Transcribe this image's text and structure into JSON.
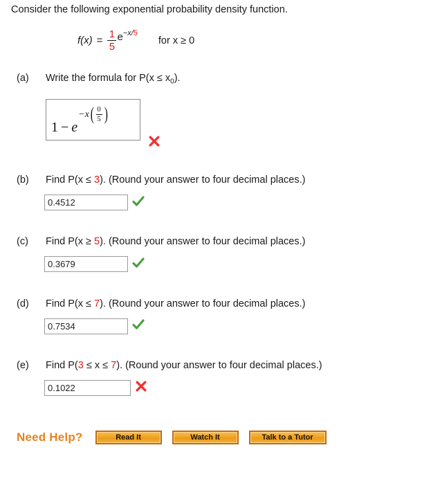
{
  "intro": "Consider the following exponential probability density function.",
  "pdf_formula": {
    "lhs": "f(x)",
    "equals": "=",
    "fraction_numerator": "1",
    "fraction_denominator": "5",
    "e_base": "e",
    "exponent_prefix": "−x/",
    "exponent_red": "5",
    "domain": "for x ≥ 0"
  },
  "parts": [
    {
      "tag": "(a)",
      "text_before": "Write the formula for P(x ≤ x",
      "subscript": "0",
      "text_after": ").",
      "answer_type": "math",
      "math": {
        "one": "1",
        "minus": "−",
        "e": "e",
        "exp_minus_x": "−x",
        "exp_num": "0",
        "exp_den": "5"
      },
      "mark": "cross"
    },
    {
      "tag": "(b)",
      "prompt_prefix": "Find P(x ≤ ",
      "prompt_value": "3",
      "prompt_suffix": "). (Round your answer to four decimal places.)",
      "answer_type": "input",
      "value": "0.4512",
      "mark": "check"
    },
    {
      "tag": "(c)",
      "prompt_prefix": "Find P(x ≥ ",
      "prompt_value": "5",
      "prompt_suffix": "). (Round your answer to four decimal places.)",
      "answer_type": "input",
      "value": "0.3679",
      "mark": "check"
    },
    {
      "tag": "(d)",
      "prompt_prefix": "Find P(x ≤ ",
      "prompt_value": "7",
      "prompt_suffix": "). (Round your answer to four decimal places.)",
      "answer_type": "input",
      "value": "0.7534",
      "mark": "check"
    },
    {
      "tag": "(e)",
      "prompt_prefix": "Find P(",
      "prompt_value_low": "3",
      "prompt_mid": " ≤ x ≤ ",
      "prompt_value_high": "7",
      "prompt_suffix": "). (Round your answer to four decimal places.)",
      "answer_type": "input",
      "value": "0.1022",
      "mark": "cross"
    }
  ],
  "need_help": {
    "label": "Need Help?",
    "buttons": [
      {
        "label": "Read It"
      },
      {
        "label": "Watch It"
      },
      {
        "label": "Talk to a Tutor"
      }
    ]
  },
  "colors": {
    "accent_orange": "#e8821e",
    "value_red": "#e01b1b",
    "check_green": "#4aa03f",
    "cross_red": "#ee3333"
  }
}
